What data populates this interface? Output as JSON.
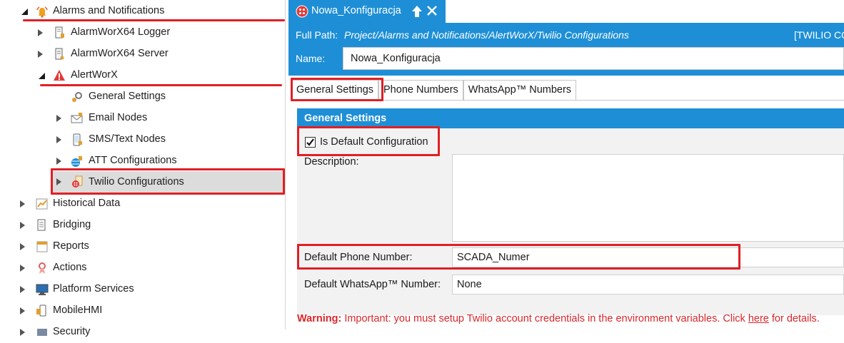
{
  "tree": {
    "items": [
      {
        "label": "Alarms and Notifications",
        "icon": "bell-alarm-icon"
      },
      {
        "label": "AlarmWorX64 Logger",
        "icon": "logger-icon"
      },
      {
        "label": "AlarmWorX64 Server",
        "icon": "server-icon"
      },
      {
        "label": "AlertWorX",
        "icon": "warning-triangle-icon"
      },
      {
        "label": "General Settings",
        "icon": "gears-icon"
      },
      {
        "label": "Email Nodes",
        "icon": "email-icon"
      },
      {
        "label": "SMS/Text Nodes",
        "icon": "mobile-phone-icon"
      },
      {
        "label": "ATT Configurations",
        "icon": "att-globe-icon"
      },
      {
        "label": "Twilio Configurations",
        "icon": "twilio-icon"
      },
      {
        "label": "Historical Data",
        "icon": "chart-icon"
      },
      {
        "label": "Bridging",
        "icon": "bridging-icon"
      },
      {
        "label": "Reports",
        "icon": "reports-icon"
      },
      {
        "label": "Actions",
        "icon": "actions-icon"
      },
      {
        "label": "Platform Services",
        "icon": "monitor-icon"
      },
      {
        "label": "MobileHMI",
        "icon": "mobile-hmi-icon"
      },
      {
        "label": "Security",
        "icon": "security-icon"
      }
    ]
  },
  "doc_tab": {
    "title": "Nowa_Konfiguracja",
    "pin_icon": "pin-up-arrow-icon",
    "close_icon": "close-icon"
  },
  "header": {
    "full_path_label": "Full Path:",
    "full_path_value": "Project/Alarms and Notifications/AlertWorX/Twilio Configurations",
    "type_tag": "[TWILIO CO",
    "name_label": "Name:",
    "name_value": "Nowa_Konfiguracja"
  },
  "tabs": [
    "General Settings",
    "Phone Numbers",
    "WhatsApp™ Numbers"
  ],
  "section": {
    "title": "General Settings",
    "is_default_label": "Is Default Configuration",
    "is_default_checked": true,
    "description_label": "Description:",
    "description_value": "",
    "default_phone_label": "Default Phone Number:",
    "default_phone_value": "SCADA_Numer",
    "default_whatsapp_label": "Default WhatsApp™ Number:",
    "default_whatsapp_value": "None"
  },
  "warning": {
    "prefix": "Warning:",
    "text": " Important: you must setup Twilio account credentials in the environment variables. Click ",
    "link": "here",
    "suffix": " for details."
  },
  "colors": {
    "accent": "#1e8fd6",
    "highlight": "#e01f26",
    "warning": "#d8262a"
  }
}
